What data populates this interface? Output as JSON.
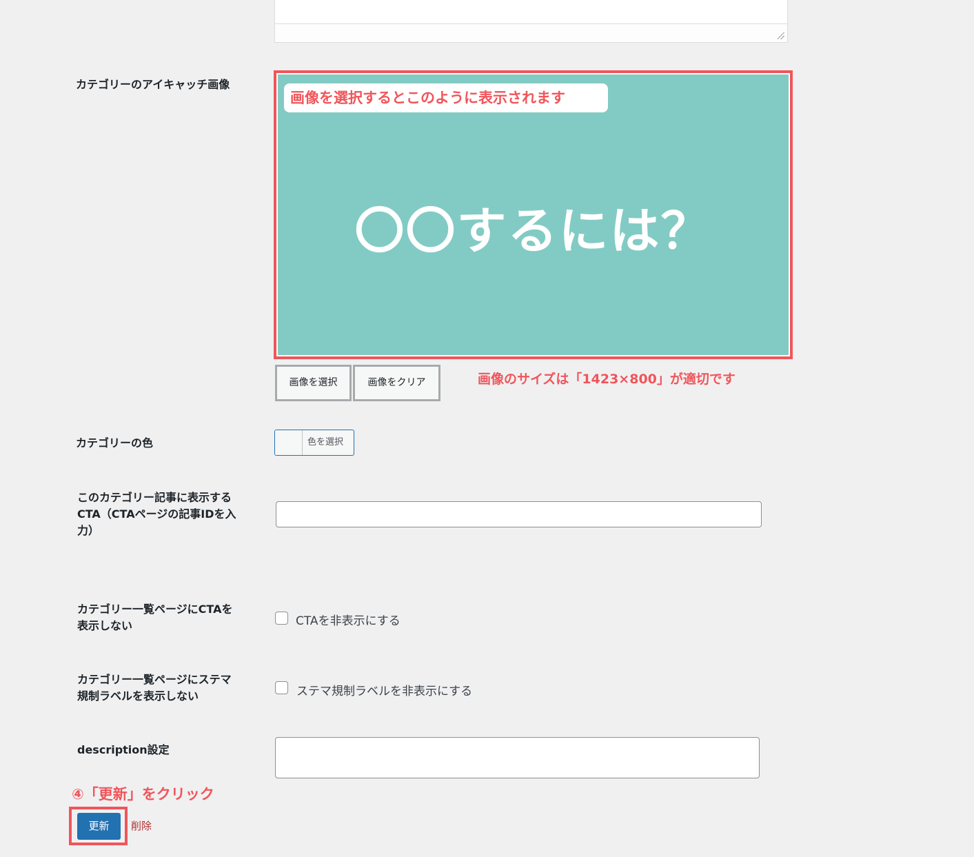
{
  "fields": {
    "eyecatch_label": "カテゴリーのアイキャッチ画像",
    "color_label": "カテゴリーの色",
    "cta_label_line1": "このカテゴリー記事に表示する",
    "cta_label_line2": "CTA（CTAページの記事IDを入",
    "cta_label_line3": "力）",
    "hide_cta_label_line1": "カテゴリー一覧ページにCTAを",
    "hide_cta_label_line2": "表示しない",
    "hide_stema_label_line1": "カテゴリー一覧ページにステマ",
    "hide_stema_label_line2": "規制ラベルを表示しない",
    "description_label": "description設定"
  },
  "preview": {
    "image_text": "〇〇するには？",
    "callout": "画像を選択するとこのように表示されます",
    "size_note": "画像のサイズは「1423×800」が適切です"
  },
  "buttons": {
    "select_image": "画像を選択",
    "clear_image": "画像をクリア",
    "select_color": "色を選択",
    "update": "更新",
    "delete": "削除"
  },
  "inputs": {
    "cta_id_value": "",
    "description_value": ""
  },
  "checkboxes": {
    "hide_cta": {
      "label": "CTAを非表示にする",
      "checked": false
    },
    "hide_stema": {
      "label": "ステマ規制ラベルを非表示にする",
      "checked": false
    }
  },
  "annotation": {
    "step4": "④「更新」をクリック"
  },
  "colors": {
    "annotation_red": "#f0555a",
    "preview_bg": "#82cbc4",
    "primary_button": "#2271b1",
    "delete_link": "#b32d2e"
  }
}
